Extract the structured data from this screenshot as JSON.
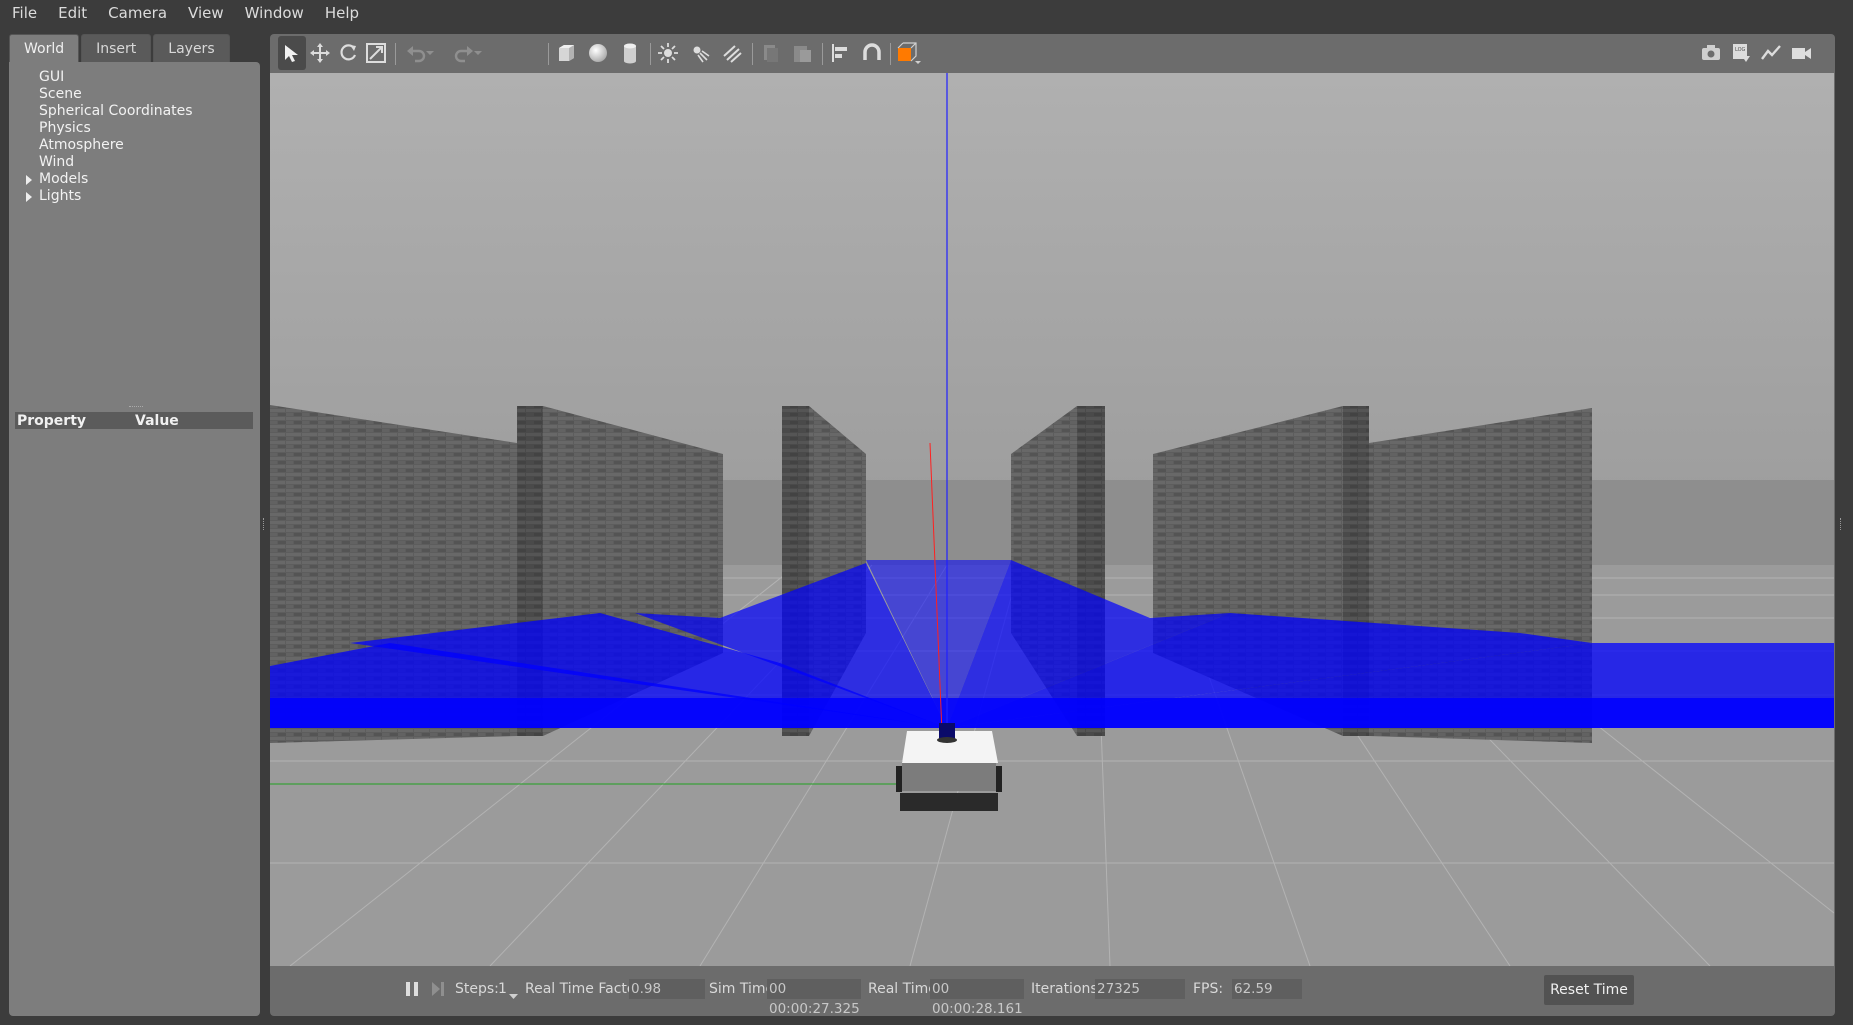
{
  "menu": [
    "File",
    "Edit",
    "Camera",
    "View",
    "Window",
    "Help"
  ],
  "left_panel": {
    "tabs": [
      "World",
      "Insert",
      "Layers"
    ],
    "active_tab": "World",
    "tree": [
      {
        "label": "GUI",
        "expandable": false
      },
      {
        "label": "Scene",
        "expandable": false
      },
      {
        "label": "Spherical Coordinates",
        "expandable": false
      },
      {
        "label": "Physics",
        "expandable": false
      },
      {
        "label": "Atmosphere",
        "expandable": false
      },
      {
        "label": "Wind",
        "expandable": false
      },
      {
        "label": "Models",
        "expandable": true
      },
      {
        "label": "Lights",
        "expandable": true
      }
    ],
    "property_header": {
      "property": "Property",
      "value": "Value"
    }
  },
  "toolbar": {
    "tools": [
      "select-mode",
      "translate-mode",
      "rotate-mode",
      "scale-mode",
      "undo",
      "redo",
      "box-shape",
      "sphere-shape",
      "cylinder-shape",
      "point-light",
      "spot-light",
      "directional-light",
      "copy",
      "paste",
      "align",
      "snap",
      "view-angle"
    ],
    "right_tools": [
      "screenshot",
      "log",
      "plot",
      "video-record"
    ]
  },
  "status": {
    "steps_label": "Steps:",
    "steps_value": "1",
    "rtf_label": "Real Time Factor:",
    "rtf_value": "0.98",
    "sim_time_label": "Sim Time:",
    "sim_time_value": "00 00:00:27.325",
    "real_time_label": "Real Time:",
    "real_time_value": "00 00:00:28.161",
    "iterations_label": "Iterations:",
    "iterations_value": "27325",
    "fps_label": "FPS:",
    "fps_value": "62.59",
    "reset_label": "Reset Time"
  },
  "colors": {
    "laser": "#0000ff",
    "wall": "#5a5a5a",
    "sky": "#a6a6a6",
    "ground": "#9a9a9a",
    "panel": "#7d7d7d",
    "menubar": "#3c3c3c"
  }
}
